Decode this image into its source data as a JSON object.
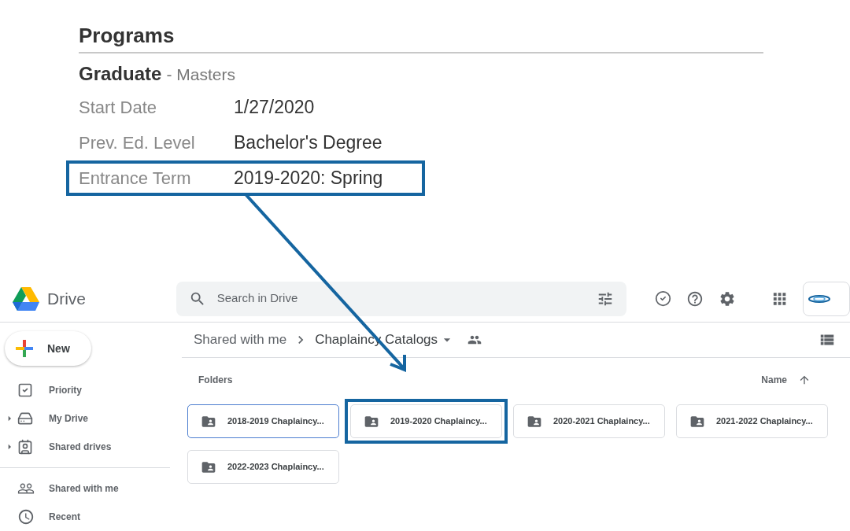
{
  "program_record": {
    "heading": "Programs",
    "level": "Graduate",
    "degree": "- Masters",
    "rows": [
      {
        "label": "Start Date",
        "value": "1/27/2020",
        "highlighted": false
      },
      {
        "label": "Prev. Ed. Level",
        "value": "Bachelor's Degree",
        "highlighted": false
      },
      {
        "label": "Entrance Term",
        "value": "2019-2020: Spring",
        "highlighted": true
      }
    ]
  },
  "drive": {
    "app_name": "Drive",
    "search": {
      "placeholder": "Search in Drive"
    },
    "new_button": "New",
    "sidebar": {
      "items": [
        {
          "label": "Priority",
          "kind": "link"
        },
        {
          "label": "My Drive",
          "kind": "tree"
        },
        {
          "label": "Shared drives",
          "kind": "tree"
        }
      ],
      "items_below": [
        {
          "label": "Shared with me"
        },
        {
          "label": "Recent"
        }
      ]
    },
    "breadcrumb": [
      "Shared with me",
      "Chaplaincy Catalogs"
    ],
    "section_title": "Folders",
    "sort": "Name",
    "folders": [
      {
        "name": "2018-2019 Chaplaincy...",
        "selected": true,
        "highlighted": false
      },
      {
        "name": "2019-2020 Chaplaincy...",
        "selected": false,
        "highlighted": true
      },
      {
        "name": "2020-2021 Chaplaincy...",
        "selected": false,
        "highlighted": false
      },
      {
        "name": "2021-2022 Chaplaincy...",
        "selected": false,
        "highlighted": false
      },
      {
        "name": "2022-2023 Chaplaincy...",
        "selected": false,
        "highlighted": false
      }
    ]
  }
}
